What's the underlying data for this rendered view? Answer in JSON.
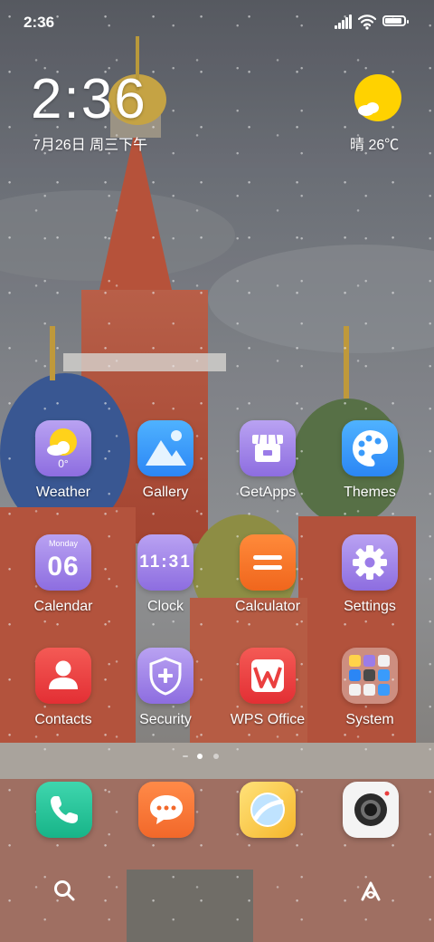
{
  "status_bar": {
    "time": "2:36",
    "battery_level": 0.9
  },
  "clock_widget": {
    "time": "2:36",
    "date": "7月26日 周三下午"
  },
  "weather_widget": {
    "condition_temp": "晴 26℃",
    "icon": "sun-icon"
  },
  "apps": [
    {
      "id": "weather",
      "label": "Weather",
      "icon": "weather-app-icon",
      "sub": "0°"
    },
    {
      "id": "gallery",
      "label": "Gallery",
      "icon": "gallery-app-icon"
    },
    {
      "id": "getapps",
      "label": "GetApps",
      "icon": "store-app-icon"
    },
    {
      "id": "themes",
      "label": "Themes",
      "icon": "palette-app-icon"
    },
    {
      "id": "calendar",
      "label": "Calendar",
      "icon": "calendar-app-icon",
      "day_name": "Monday",
      "day_num": "06"
    },
    {
      "id": "clock",
      "label": "Clock",
      "icon": "clock-app-icon",
      "time": "11:31"
    },
    {
      "id": "calculator",
      "label": "Calculator",
      "icon": "calculator-app-icon"
    },
    {
      "id": "settings",
      "label": "Settings",
      "icon": "gear-app-icon"
    },
    {
      "id": "contacts",
      "label": "Contacts",
      "icon": "contacts-app-icon"
    },
    {
      "id": "security",
      "label": "Security",
      "icon": "shield-app-icon"
    },
    {
      "id": "wps",
      "label": "WPS Office",
      "icon": "wps-app-icon"
    },
    {
      "id": "system",
      "label": "System",
      "icon": "folder-icon"
    }
  ],
  "page_indicator": {
    "pages": 2,
    "current": 1
  },
  "dock": [
    {
      "id": "phone",
      "icon": "phone-icon"
    },
    {
      "id": "messages",
      "icon": "messages-icon"
    },
    {
      "id": "browser",
      "icon": "browser-icon"
    },
    {
      "id": "camera",
      "icon": "camera-icon"
    }
  ],
  "bottom_bar": {
    "left": "search-icon",
    "right": "assistant-icon"
  },
  "colors": {
    "purple": "#9b7ce8",
    "blue": "#3a9bfb",
    "orange": "#f5762b",
    "red": "#ea3f3f",
    "green": "#1fbf94",
    "yellow": "#ffd400"
  }
}
